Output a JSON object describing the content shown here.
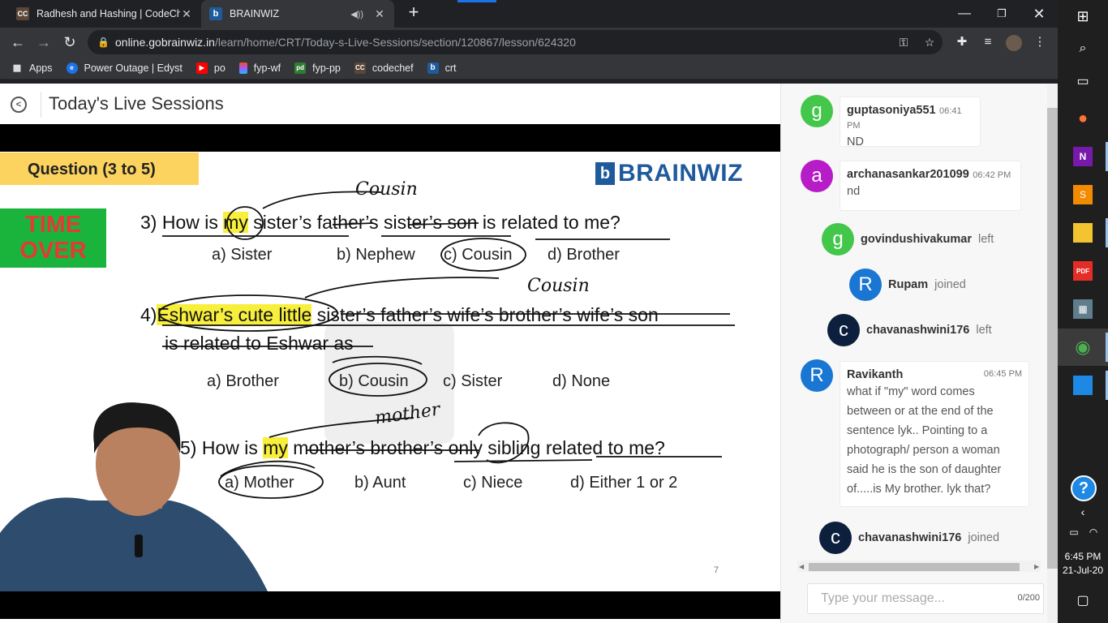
{
  "browser": {
    "tabs": [
      {
        "title": "Radhesh and Hashing | CodeChef",
        "favicon": "CC",
        "active": false
      },
      {
        "title": "BRAINWIZ",
        "favicon": "b",
        "active": true
      }
    ],
    "url_host": "online.gobrainwiz.in",
    "url_path": "/learn/home/CRT/Today-s-Live-Sessions/section/120867/lesson/624320",
    "bookmarks": [
      {
        "label": "Apps",
        "icon": "apps-grid-icon",
        "color": "#e8eaed"
      },
      {
        "label": "Power Outage | Edyst",
        "icon": "edyst-icon",
        "color": "#1a73e8"
      },
      {
        "label": "po",
        "icon": "youtube-icon",
        "color": "#ff0000"
      },
      {
        "label": "fyp-wf",
        "icon": "figma-icon",
        "color": "#a259ff"
      },
      {
        "label": "fyp-pp",
        "icon": "pd-icon",
        "color": "#2e7d32"
      },
      {
        "label": "codechef",
        "icon": "codechef-icon",
        "color": "#5b4638"
      },
      {
        "label": "crt",
        "icon": "brainwiz-icon",
        "color": "#1f5a9b"
      }
    ]
  },
  "page": {
    "title": "Today's Live Sessions"
  },
  "slide": {
    "banner": "Question (3 to 5)",
    "brand": "BRAINWIZ",
    "time_over_1": "TIME",
    "time_over_2": "OVER",
    "q3": {
      "prefix": "3) How is ",
      "hl": "my",
      "rest": " sister’s father’s sister’s son is related to me?",
      "options": [
        "a) Sister",
        "b) Nephew",
        "c) Cousin",
        "d) Brother"
      ],
      "annotation": "Cousin"
    },
    "q4": {
      "prefix": "4)",
      "hl": "Eshwar’s cute little",
      "rest": " sister’s father’s wife’s brother’s wife’s son",
      "line2": "is related to Eshwar as",
      "options": [
        "a) Brother",
        "b) Cousin",
        "c) Sister",
        "d) None"
      ],
      "annotation": "Cousin"
    },
    "q5": {
      "prefix": "5) How is ",
      "hl": "my",
      "rest": " mother’s brother’s only sibling related to me?",
      "options": [
        "a) Mother",
        "b) Aunt",
        "c) Niece",
        "d) Either 1 or 2"
      ],
      "annotation": "mother"
    },
    "page_number": "7"
  },
  "chat": {
    "messages": [
      {
        "type": "message",
        "initial": "g",
        "user": "guptasoniya551",
        "time": "06:41 PM",
        "text": "ND",
        "color": "#43c74a"
      },
      {
        "type": "message",
        "initial": "a",
        "user": "archanasankar201099",
        "time": "06:42 PM",
        "text": "nd",
        "color": "#b61cc7"
      },
      {
        "type": "event",
        "initial": "g",
        "user": "govindushivakumar",
        "event": "left",
        "color": "#43c74a"
      },
      {
        "type": "event",
        "initial": "R",
        "user": "Rupam",
        "event": "joined",
        "color": "#1976d2"
      },
      {
        "type": "event",
        "initial": "c",
        "user": "chavanashwini176",
        "event": "left",
        "color": "#0c1f3d"
      },
      {
        "type": "message",
        "initial": "R",
        "user": "Ravikanth",
        "time": "06:45 PM",
        "text": "what if \"my\" word comes between or at the end of the sentence lyk.. Pointing to a photograph/ person a woman said he is the son of daughter of.....is My brother. lyk that?",
        "color": "#1976d2"
      },
      {
        "type": "event",
        "initial": "c",
        "user": "chavanashwini176",
        "event": "joined",
        "color": "#0c1f3d"
      }
    ],
    "input_placeholder": "Type your message...",
    "char_count": "0/200"
  },
  "taskbar": {
    "time": "6:45 PM",
    "date": "21-Jul-20"
  }
}
